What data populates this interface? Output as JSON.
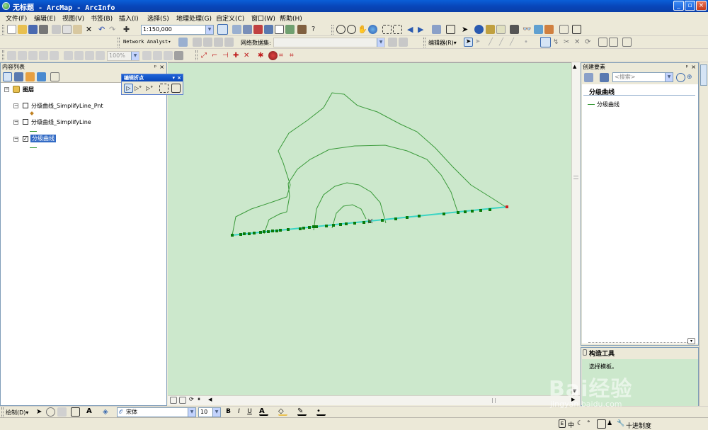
{
  "window": {
    "title": "无标题 - ArcMap - ArcInfo",
    "controls": [
      "_",
      "▫",
      "×"
    ]
  },
  "menu": [
    "文件(F)",
    "编辑(E)",
    "视图(V)",
    "书签(B)",
    "插入(I)",
    "选择(S)",
    "地理处理(G)",
    "自定义(C)",
    "窗口(W)",
    "帮助(H)"
  ],
  "toolbar": {
    "scale": "1:150,000",
    "network_analyst": "Network Analyst▾",
    "network_dataset_label": "网络数据集:",
    "editor_label": "编辑器(R)▾",
    "zoom_pct": "100%"
  },
  "toc": {
    "title": "内容列表",
    "pin": "ᵖ",
    "close": "×",
    "root_label": "图层",
    "layers": [
      {
        "name": "分级曲线_SimplifyLine_Pnt",
        "checked": false
      },
      {
        "name": "分级曲线_SimplifyLine",
        "checked": false
      },
      {
        "name": "分级曲线",
        "checked": true
      }
    ]
  },
  "edit_vertices": {
    "title": "编辑折点",
    "close": "×"
  },
  "create_features": {
    "title": "创建要素",
    "search_placeholder": "<搜索>",
    "group": "分级曲线",
    "template": "分级曲线"
  },
  "construction_tools": {
    "title": "构造工具",
    "hint": "选择模板。"
  },
  "drawing": {
    "draw_label": "绘制(D)▾",
    "font": "宋体",
    "font_size": "10",
    "bold": "B",
    "italic": "I",
    "underline": "U",
    "text_tool": "A"
  },
  "status": {
    "items": [
      "中",
      "十进制度"
    ]
  },
  "watermark": {
    "main": "Bai经验",
    "sub": "jingyan.baidu.com"
  },
  "colors": {
    "map_bg": "#cce8cc",
    "contour": "#3a9a3a",
    "selected_line": "#3ad4c4",
    "vertex": "#0a7a0a",
    "last_vertex": "#d02020"
  }
}
